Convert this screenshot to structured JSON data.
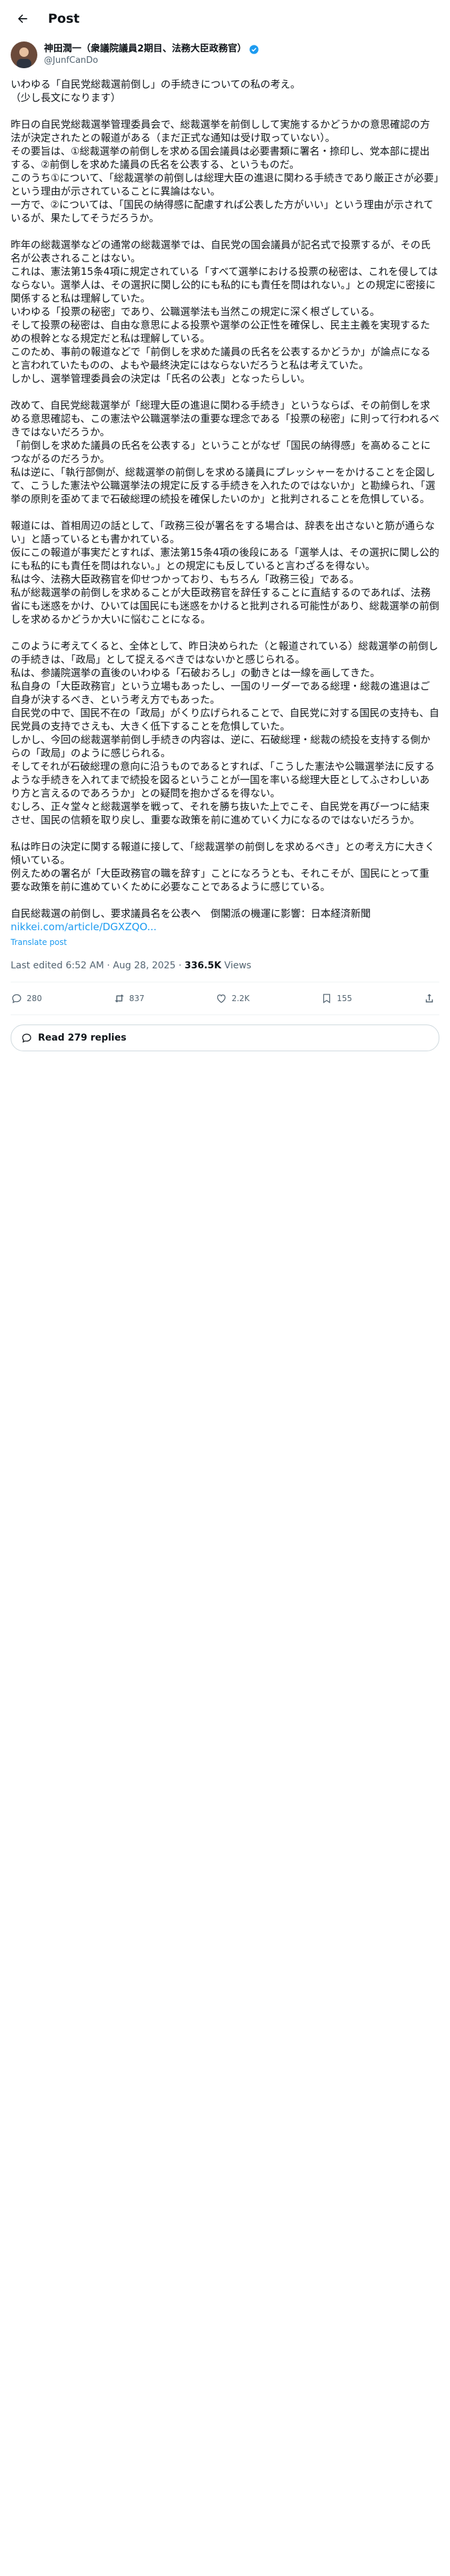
{
  "header": {
    "title": "Post"
  },
  "author": {
    "name": "神田潤一（衆議院議員2期目、法務大臣政務官）",
    "handle": "@JunfCanDo"
  },
  "paragraphs": [
    "いわゆる「自民党総裁選前倒し」の手続きについての私の考え。\n（少し長文になります）",
    "昨日の自民党総裁選挙管理委員会で、総裁選挙を前倒しして実施するかどうかの意思確認の方法が決定されたとの報道がある（まだ正式な通知は受け取っていない）。\nその要旨は、①総裁選挙の前倒しを求める国会議員は必要書類に署名・捺印し、党本部に提出する、②前倒しを求めた議員の氏名を公表する、というものだ。\nこのうち①について、「総裁選挙の前倒しは総理大臣の進退に関わる手続きであり厳正さが必要」という理由が示されていることに異論はない。\n一方で、②については、「国民の納得感に配慮すれば公表した方がいい」という理由が示されているが、果たしてそうだろうか。",
    "昨年の総裁選挙などの通常の総裁選挙では、自民党の国会議員が記名式で投票するが、その氏名が公表されることはない。\nこれは、憲法第15条4項に規定されている「すべて選挙における投票の秘密は、これを侵してはならない。選挙人は、その選択に関し公的にも私的にも責任を問はれない。」との規定に密接に関係すると私は理解していた。\nいわゆる「投票の秘密」であり、公職選挙法も当然この規定に深く根ざしている。\nそして投票の秘密は、自由な意思による投票や選挙の公正性を確保し、民主主義を実現するための根幹となる規定だと私は理解している。\nこのため、事前の報道などで「前倒しを求めた議員の氏名を公表するかどうか」が論点になると言われていたものの、よもや最終決定にはならないだろうと私は考えていた。\nしかし、選挙管理委員会の決定は「氏名の公表」となったらしい。",
    "改めて、自民党総裁選挙が「総理大臣の進退に関わる手続き」というならば、その前倒しを求める意思確認も、この憲法や公職選挙法の重要な理念である「投票の秘密」に則って行われるべきではないだろうか。\n「前倒しを求めた議員の氏名を公表する」ということがなぜ「国民の納得感」を高めることにつながるのだろうか。\n私は逆に、「執行部側が、総裁選挙の前倒しを求める議員にプレッシャーをかけることを企図して、こうした憲法や公職選挙法の規定に反する手続きを入れたのではないか」と勘繰られ、「選挙の原則を歪めてまで石破総理の続投を確保したいのか」と批判されることを危惧している。",
    "報道には、首相周辺の話として、「政務三役が署名をする場合は、辞表を出さないと筋が通らない」と語っているとも書かれている。\n仮にこの報道が事実だとすれば、憲法第15条4項の後段にある「選挙人は、その選択に関し公的にも私的にも責任を問はれない。」との規定にも反していると言わざるを得ない。\n私は今、法務大臣政務官を仰せつかっており、もちろん「政務三役」である。\n私が総裁選挙の前倒しを求めることが大臣政務官を辞任することに直結するのであれば、法務省にも迷惑をかけ、ひいては国民にも迷惑をかけると批判される可能性があり、総裁選挙の前倒しを求めるかどうか大いに悩むことになる。",
    "このように考えてくると、全体として、昨日決められた（と報道されている）総裁選挙の前倒しの手続きは、「政局」として捉えるべきではないかと感じられる。\n私は、参議院選挙の直後のいわゆる「石破おろし」の動きとは一線を画してきた。\n私自身の「大臣政務官」という立場もあったし、一国のリーダーである総理・総裁の進退はご自身が決するべき、という考え方でもあった。\n自民党の中で、国民不在の「政局」がくり広げられることで、自民党に対する国民の支持も、自民党員の支持でさえも、大きく低下することを危惧していた。\nしかし、今回の総裁選挙前倒し手続きの内容は、逆に、石破総理・総裁の続投を支持する側からの「政局」のように感じられる。\nそしてそれが石破総理の意向に沿うものであるとすれば、「こうした憲法や公職選挙法に反するような手続きを入れてまで続投を図るということが一国を率いる総理大臣としてふさわしいあり方と言えるのであろうか」との疑問を抱かざるを得ない。\nむしろ、正々堂々と総裁選挙を戦って、それを勝ち抜いた上でこそ、自民党を再びーつに結束させ、国民の信頼を取り戻し、重要な政策を前に進めていく力になるのではないだろうか。",
    "私は昨日の決定に関する報道に接して、「総裁選挙の前倒しを求めるべき」との考え方に大きく傾いている。\n例えための署名が「大臣政務官の職を辞す」ことになろうとも、それこそが、国民にとって重要な政策を前に進めていくために必要なことであるように感じている。",
    "自民総裁選の前倒し、要求議員名を公表へ　倒閣派の機運に影響：日本経済新聞"
  ],
  "link_text": "nikkei.com/article/DGXZQO...",
  "translate": "Translate post",
  "meta": {
    "prefix": "Last edited 6:52 AM · Aug 28, 2025 · ",
    "views": "336.5K",
    "views_label": " Views"
  },
  "actions": {
    "replies": "280",
    "reposts": "837",
    "likes": "2.2K",
    "bookmarks": "155"
  },
  "read_replies": "Read 279 replies",
  "colors": {
    "accent": "#1d9bf0",
    "text": "#0f1419",
    "muted": "#536471"
  }
}
